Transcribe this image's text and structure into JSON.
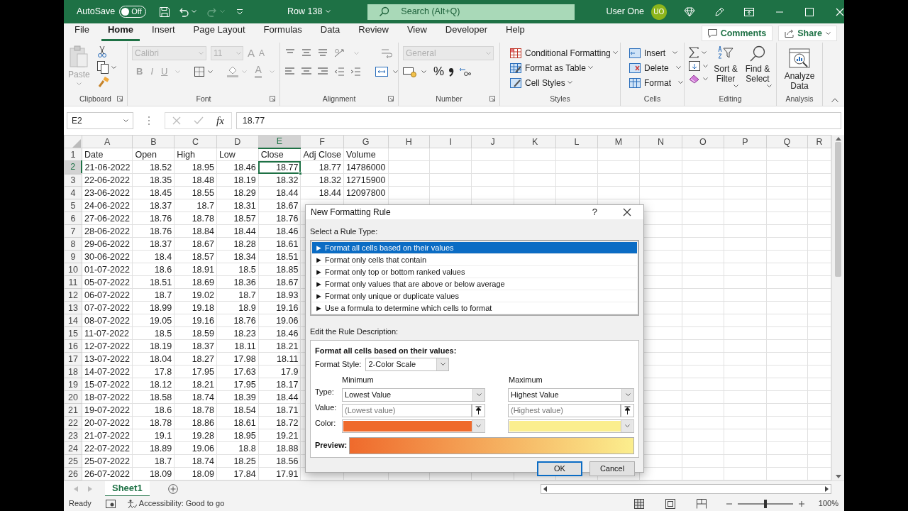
{
  "title_bar": {
    "autosave_label": "AutoSave",
    "autosave_state": "Off",
    "autosave_on": false,
    "document_title": "Row 138",
    "search_placeholder": "Search (Alt+Q)",
    "user_name": "User One",
    "user_initials": "UO"
  },
  "menu_tabs": [
    {
      "label": "File",
      "selected": false
    },
    {
      "label": "Home",
      "selected": true
    },
    {
      "label": "Insert",
      "selected": false
    },
    {
      "label": "Page Layout",
      "selected": false
    },
    {
      "label": "Formulas",
      "selected": false
    },
    {
      "label": "Data",
      "selected": false
    },
    {
      "label": "Review",
      "selected": false
    },
    {
      "label": "View",
      "selected": false
    },
    {
      "label": "Developer",
      "selected": false
    },
    {
      "label": "Help",
      "selected": false
    }
  ],
  "comments_button": "Comments",
  "share_button": "Share",
  "ribbon": {
    "clipboard": {
      "paste": "Paste",
      "label": "Clipboard"
    },
    "font": {
      "font_name": "Calibri",
      "font_size": "11",
      "grow": "A",
      "shrink": "A",
      "bold": "B",
      "italic": "I",
      "underline": "U",
      "font_color": "A",
      "disabled": true,
      "label": "Font"
    },
    "alignment": {
      "label": "Alignment"
    },
    "number": {
      "format": "General",
      "disabled": true,
      "percent": "%",
      "label": "Number"
    },
    "styles": {
      "items": [
        "Conditional Formatting",
        "Format as Table",
        "Cell Styles"
      ],
      "label": "Styles"
    },
    "cells": {
      "items": [
        "Insert",
        "Delete",
        "Format"
      ],
      "label": "Cells"
    },
    "editing": {
      "items": [
        "Sort & Filter",
        "Find & Select"
      ],
      "label": "Editing"
    },
    "analysis": {
      "items": [
        "Analyze Data"
      ],
      "label": "Analysis"
    }
  },
  "formula_bar": {
    "name_box": "E2",
    "function_label": "fx",
    "value": "18.77"
  },
  "grid": {
    "columns": [
      {
        "label": "A",
        "selected": false
      },
      {
        "label": "B",
        "selected": false
      },
      {
        "label": "C",
        "selected": false
      },
      {
        "label": "D",
        "selected": false
      },
      {
        "label": "E",
        "selected": true
      },
      {
        "label": "F",
        "selected": false
      },
      {
        "label": "G",
        "selected": false
      },
      {
        "label": "H",
        "selected": false
      },
      {
        "label": "I",
        "selected": false
      },
      {
        "label": "J",
        "selected": false
      },
      {
        "label": "K",
        "selected": false
      },
      {
        "label": "L",
        "selected": false
      },
      {
        "label": "M",
        "selected": false
      },
      {
        "label": "N",
        "selected": false
      },
      {
        "label": "O",
        "selected": false
      },
      {
        "label": "P",
        "selected": false
      },
      {
        "label": "Q",
        "selected": false
      },
      {
        "label": "R",
        "selected": false
      }
    ],
    "rows": [
      {
        "number": "1",
        "kind": "header",
        "selected": false,
        "cells": [
          "Date",
          "Open",
          "High",
          "Low",
          "Close",
          "Adj Close",
          "Volume"
        ]
      },
      {
        "number": "2",
        "kind": "data",
        "selected": true,
        "cells": [
          "21-06-2022",
          "18.52",
          "18.95",
          "18.46",
          "18.77",
          "18.77",
          "14786000"
        ]
      },
      {
        "number": "3",
        "kind": "data",
        "selected": false,
        "cells": [
          "22-06-2022",
          "18.35",
          "18.48",
          "18.19",
          "18.32",
          "18.32",
          "12715900"
        ]
      },
      {
        "number": "4",
        "kind": "data",
        "selected": false,
        "cells": [
          "23-06-2022",
          "18.45",
          "18.55",
          "18.29",
          "18.44",
          "18.44",
          "12097800"
        ]
      },
      {
        "number": "5",
        "kind": "data",
        "selected": false,
        "cells": [
          "24-06-2022",
          "18.37",
          "18.7",
          "18.31",
          "18.67"
        ]
      },
      {
        "number": "6",
        "kind": "data",
        "selected": false,
        "cells": [
          "27-06-2022",
          "18.76",
          "18.78",
          "18.57",
          "18.76"
        ]
      },
      {
        "number": "7",
        "kind": "data",
        "selected": false,
        "cells": [
          "28-06-2022",
          "18.76",
          "18.84",
          "18.44",
          "18.46"
        ]
      },
      {
        "number": "8",
        "kind": "data",
        "selected": false,
        "cells": [
          "29-06-2022",
          "18.37",
          "18.67",
          "18.28",
          "18.61"
        ]
      },
      {
        "number": "9",
        "kind": "data",
        "selected": false,
        "cells": [
          "30-06-2022",
          "18.4",
          "18.57",
          "18.34",
          "18.51"
        ]
      },
      {
        "number": "10",
        "kind": "data",
        "selected": false,
        "cells": [
          "01-07-2022",
          "18.6",
          "18.91",
          "18.5",
          "18.85"
        ]
      },
      {
        "number": "11",
        "kind": "data",
        "selected": false,
        "cells": [
          "05-07-2022",
          "18.51",
          "18.69",
          "18.36",
          "18.67"
        ]
      },
      {
        "number": "12",
        "kind": "data",
        "selected": false,
        "cells": [
          "06-07-2022",
          "18.7",
          "19.02",
          "18.7",
          "18.93"
        ]
      },
      {
        "number": "13",
        "kind": "data",
        "selected": false,
        "cells": [
          "07-07-2022",
          "18.99",
          "19.18",
          "18.9",
          "19.16"
        ]
      },
      {
        "number": "14",
        "kind": "data",
        "selected": false,
        "cells": [
          "08-07-2022",
          "19.05",
          "19.16",
          "18.76",
          "19.06"
        ]
      },
      {
        "number": "15",
        "kind": "data",
        "selected": false,
        "cells": [
          "11-07-2022",
          "18.5",
          "18.59",
          "18.23",
          "18.46"
        ]
      },
      {
        "number": "16",
        "kind": "data",
        "selected": false,
        "cells": [
          "12-07-2022",
          "18.19",
          "18.37",
          "18.11",
          "18.21"
        ]
      },
      {
        "number": "17",
        "kind": "data",
        "selected": false,
        "cells": [
          "13-07-2022",
          "18.04",
          "18.27",
          "17.98",
          "18.11"
        ]
      },
      {
        "number": "18",
        "kind": "data",
        "selected": false,
        "cells": [
          "14-07-2022",
          "17.8",
          "17.95",
          "17.63",
          "17.9"
        ]
      },
      {
        "number": "19",
        "kind": "data",
        "selected": false,
        "cells": [
          "15-07-2022",
          "18.12",
          "18.21",
          "17.95",
          "18.17"
        ]
      },
      {
        "number": "20",
        "kind": "data",
        "selected": false,
        "cells": [
          "18-07-2022",
          "18.58",
          "18.74",
          "18.39",
          "18.44"
        ]
      },
      {
        "number": "21",
        "kind": "data",
        "selected": false,
        "cells": [
          "19-07-2022",
          "18.6",
          "18.78",
          "18.54",
          "18.71"
        ]
      },
      {
        "number": "22",
        "kind": "data",
        "selected": false,
        "cells": [
          "20-07-2022",
          "18.78",
          "18.86",
          "18.61",
          "18.72"
        ]
      },
      {
        "number": "23",
        "kind": "data",
        "selected": false,
        "cells": [
          "21-07-2022",
          "19.1",
          "19.28",
          "18.95",
          "19.21"
        ]
      },
      {
        "number": "24",
        "kind": "data",
        "selected": false,
        "cells": [
          "22-07-2022",
          "18.89",
          "19.06",
          "18.8",
          "18.88"
        ]
      },
      {
        "number": "25",
        "kind": "data",
        "selected": false,
        "cells": [
          "25-07-2022",
          "18.7",
          "18.74",
          "18.25",
          "18.56"
        ]
      },
      {
        "number": "26",
        "kind": "data",
        "selected": false,
        "cells": [
          "26-07-2022",
          "18.09",
          "18.09",
          "17.84",
          "17.91"
        ]
      }
    ]
  },
  "dialog": {
    "title": "New Formatting Rule",
    "help": "?",
    "rule_type_label": "Select a Rule Type:",
    "rule_types": [
      {
        "label": "► Format all cells based on their values",
        "selected": true
      },
      {
        "label": "► Format only cells that contain",
        "selected": false
      },
      {
        "label": "► Format only top or bottom ranked values",
        "selected": false
      },
      {
        "label": "► Format only values that are above or below average",
        "selected": false
      },
      {
        "label": "► Format only unique or duplicate values",
        "selected": false
      },
      {
        "label": "► Use a formula to determine which cells to format",
        "selected": false
      }
    ],
    "description_label": "Edit the Rule Description:",
    "description_heading": "Format all cells based on their values:",
    "format_style_label": "Format Style:",
    "format_style": "2-Color Scale",
    "type_label": "Type:",
    "value_label": "Value:",
    "color_label": "Color:",
    "ends": [
      {
        "heading": "Minimum",
        "type": "Lowest Value",
        "value_placeholder": "(Lowest value)",
        "color": "#ef6a2c"
      },
      {
        "heading": "Maximum",
        "type": "Highest Value",
        "value_placeholder": "(Highest value)",
        "color": "#fbee8e"
      }
    ],
    "preview_label": "Preview:",
    "buttons": [
      {
        "label": "OK",
        "default": true
      },
      {
        "label": "Cancel",
        "default": false
      }
    ]
  },
  "sheet_tabs": [
    {
      "label": "Sheet1",
      "selected": true
    }
  ],
  "status_bar": {
    "mode": "Ready",
    "accessibility": "Accessibility: Good to go",
    "zoom": "100%",
    "zoom_slider": {
      "level": 0.5
    }
  }
}
